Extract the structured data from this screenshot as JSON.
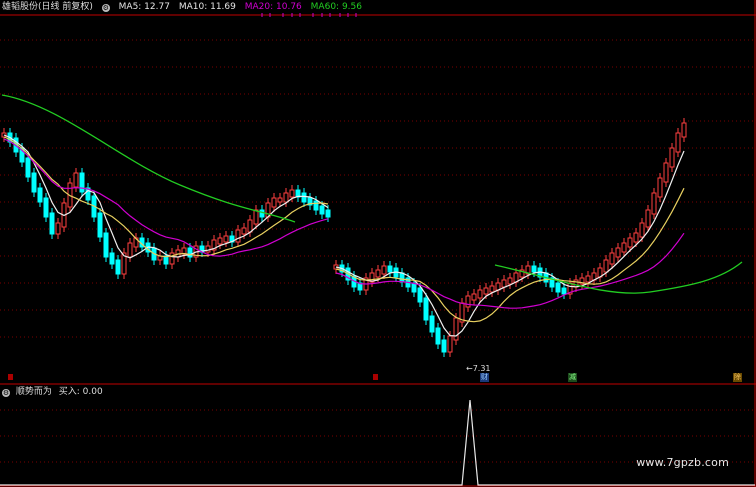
{
  "header": {
    "stock_title": "雄韬股份(日线 前复权)",
    "settings_glyph": "⚙",
    "ma": [
      {
        "label": "MA5: 12.77",
        "color": "#e6e6e6"
      },
      {
        "label": "MA10: 11.69",
        "color": "#e6e6e6"
      },
      {
        "label": "MA20: 10.76",
        "color": "#d000d0"
      },
      {
        "label": "MA60: 9.56",
        "color": "#22cc22"
      }
    ]
  },
  "indicator": {
    "label": "顺势而为",
    "buy_text": "买入: 0.00"
  },
  "annotations": {
    "low_price": "7.31",
    "markers": [
      {
        "text": "财",
        "name": "marker-finance-report",
        "color": "#5a9fff"
      },
      {
        "text": "减",
        "name": "marker-reduce",
        "color": "#4caf50"
      },
      {
        "text": "除",
        "name": "marker-ex-dividend",
        "color": "#e0a020"
      }
    ]
  },
  "watermark": "www.7gpzb.com",
  "colors": {
    "up": "#ff4040",
    "down": "#00ffff",
    "grid": "#7a0000",
    "border": "#c00000",
    "ma5": "#f0f0f0",
    "ma10": "#e8d060",
    "ma20": "#d000d0",
    "ma60": "#22cc22"
  },
  "chart_data": {
    "type": "candlestick",
    "series": [
      {
        "name": "MA5"
      },
      {
        "name": "MA10"
      },
      {
        "name": "MA20"
      },
      {
        "name": "MA60"
      }
    ],
    "price_low": 7.31
  }
}
